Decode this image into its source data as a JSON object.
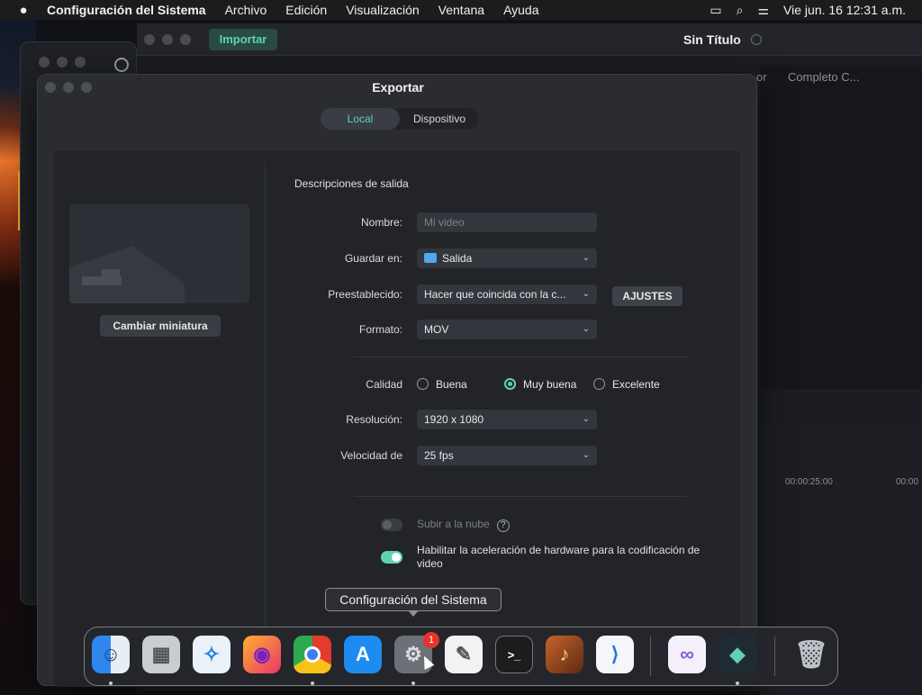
{
  "menubar": {
    "app_name": "Configuración del Sistema",
    "items": [
      "Archivo",
      "Edición",
      "Visualización",
      "Ventana",
      "Ayuda"
    ],
    "clock": "Vie jun. 16  12:31 a.m."
  },
  "app": {
    "import_label": "Importar",
    "title": "Sin Título",
    "right_label": "Completo C...",
    "right_prefix": "or",
    "timecode": "00:00:25:00",
    "timecode2": "00:00"
  },
  "dialog": {
    "title": "Exportar",
    "tabs": [
      "Local",
      "Dispositivo"
    ],
    "active_tab": "Local",
    "thumbnail_button": "Cambiar miniatura",
    "section_title": "Descripciones de salida",
    "name_label": "Nombre:",
    "name_placeholder": "Mi video",
    "save_label": "Guardar en:",
    "save_value": "Salida",
    "preset_label": "Preestablecido:",
    "preset_value": "Hacer que coincida con la c...",
    "settings_button": "AJUSTES",
    "format_label": "Formato:",
    "format_value": "MOV",
    "quality_label": "Calidad",
    "quality_options": [
      "Buena",
      "Muy buena",
      "Excelente"
    ],
    "quality_selected": "Muy buena",
    "resolution_label": "Resolución:",
    "resolution_value": "1920 x 1080",
    "framerate_label": "Velocidad de",
    "framerate_value": "25 fps",
    "cloud_label": "Subir a la nube",
    "cloud_enabled": false,
    "hw_label": "Habilitar la aceleración de hardware para la codificación de video",
    "hw_enabled": true
  },
  "dock": {
    "tooltip": "Configuración del Sistema",
    "badge": "1",
    "apps": [
      "Finder",
      "Launchpad",
      "Safari",
      "Firefox",
      "Chrome",
      "App Store",
      "Configuración del Sistema",
      "TextEdit",
      "Terminal",
      "GarageBand",
      "VS Code",
      "Visual Studio",
      "Filmora",
      "Papelera"
    ]
  },
  "colors": {
    "accent": "#5fd3b0",
    "dialog_bg": "#2a2c31"
  }
}
